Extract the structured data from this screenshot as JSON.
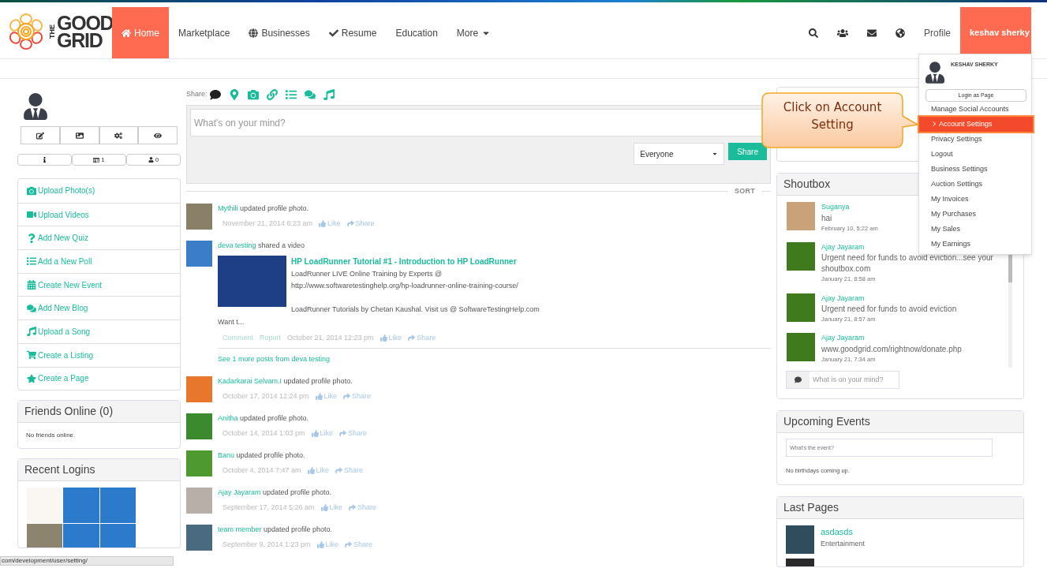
{
  "nav": {
    "logo": {
      "small": "THE",
      "top": "GOOD",
      "bottom": "GRID"
    },
    "items": [
      {
        "label": "Home",
        "kind": "home",
        "selected": true
      },
      {
        "label": "Marketplace",
        "kind": "plain",
        "selected": false
      },
      {
        "label": "Businesses",
        "kind": "globe",
        "selected": false
      },
      {
        "label": "Resume",
        "kind": "check",
        "selected": false
      },
      {
        "label": "Education",
        "kind": "plain",
        "selected": false
      },
      {
        "label": "More",
        "kind": "dropdown",
        "selected": false
      }
    ],
    "profile": "Profile",
    "user": "keshav sherky"
  },
  "user_menu": {
    "name": "KESHAV SHERKY",
    "login_button": "Login as Page",
    "items": [
      {
        "label": "Manage Social Accounts",
        "selected": false
      },
      {
        "label": "Account Settings",
        "selected": true
      },
      {
        "label": "Privacy Settings",
        "selected": false
      },
      {
        "label": "Logout",
        "selected": false
      },
      {
        "label": "Business Settings",
        "selected": false
      },
      {
        "label": "Auction Settings",
        "selected": false
      },
      {
        "label": "My Invoices",
        "selected": false
      },
      {
        "label": "My Purchases",
        "selected": false
      },
      {
        "label": "My Sales",
        "selected": false
      },
      {
        "label": "My Earnings",
        "selected": false
      }
    ]
  },
  "callout": {
    "text": "Click on Account Setting"
  },
  "left": {
    "stats": [
      {
        "kind": "photos",
        "value": "1"
      },
      {
        "kind": "friends",
        "value": "0"
      }
    ],
    "actions": [
      {
        "label": "Upload Photo(s)",
        "kind": "photo"
      },
      {
        "label": "Upload Videos",
        "kind": "video"
      },
      {
        "label": "Add New Quiz",
        "kind": "quiz"
      },
      {
        "label": "Add a New Poll",
        "kind": "poll"
      },
      {
        "label": "Create New Event",
        "kind": "event"
      },
      {
        "label": "Add New Blog",
        "kind": "blog"
      },
      {
        "label": "Upload a Song",
        "kind": "song"
      },
      {
        "label": "Create a Listing",
        "kind": "listing"
      },
      {
        "label": "Create a Page",
        "kind": "page"
      }
    ],
    "friends_online": {
      "title": "Friends Online (0)",
      "empty_text": "No friends online."
    },
    "recent_logins": {
      "title": "Recent Logins"
    }
  },
  "composer": {
    "share_label": "Share:",
    "placeholder": "What's on your mind?",
    "audience": "Everyone",
    "button": "Share",
    "sort": "SORT"
  },
  "feed": [
    {
      "kind": "photo",
      "author": "Mythili",
      "action": "updated profile photo.",
      "date": "November 21, 2014 6:23 am",
      "like": "Like",
      "share": "Share"
    },
    {
      "kind": "video",
      "author": "deva testing",
      "action": "shared a video",
      "date": "October 21, 2014 12:23 pm",
      "like": "Like",
      "share": "Share",
      "video": {
        "title": "HP LoadRunner Tutorial #1 - Introduction to HP LoadRunner",
        "lines": [
          "LoadRunner LIVE Online Training by Experts @",
          "http://www.softwaretestinghelp.org/hp-loadrunner-online-training-course/",
          "LoadRunner Tutorials by Chetan Kaushal. Visit us @ SoftwareTestingHelp.com"
        ],
        "more": "Want t...",
        "comment": "Comment",
        "report": "Report",
        "see_more": "See 1 more posts from deva testing"
      }
    },
    {
      "kind": "photo",
      "author": "Kadarkarai Selvam.I",
      "action": "updated profile photo.",
      "date": "October 17, 2014 12:24 pm",
      "like": "Like",
      "share": "Share"
    },
    {
      "kind": "photo",
      "author": "Anitha",
      "action": "updated profile photo.",
      "date": "October 14, 2014 1:03 pm",
      "like": "Like",
      "share": "Share"
    },
    {
      "kind": "photo",
      "author": "Banu",
      "action": "updated profile photo.",
      "date": "October 4, 2014 7:47 am",
      "like": "Like",
      "share": "Share"
    },
    {
      "kind": "photo",
      "author": "Ajay Jayaram",
      "action": "updated profile photo.",
      "date": "September 17, 2014 5:26 am",
      "like": "Like",
      "share": "Share"
    },
    {
      "kind": "photo",
      "author": "team member",
      "action": "updated profile photo.",
      "date": "September 9, 2014 1:23 pm",
      "like": "Like",
      "share": "Share"
    }
  ],
  "shoutbox": {
    "title": "Shoutbox",
    "messages": [
      {
        "author": "Suganya",
        "text": "hai",
        "time": "February 10, 5:22 am"
      },
      {
        "author": "Ajay Jayaram",
        "text": "Urgent need for funds to avoid eviction...see your shoutbox.com",
        "time": "January 21, 8:58 am"
      },
      {
        "author": "Ajay Jayaram",
        "text": "Urgent need for funds to avoid eviction",
        "time": "January 21, 8:57 am"
      },
      {
        "author": "Ajay Jayaram",
        "text": "www.goodgrid.com/rightnow/donate.php",
        "time": "January 21, 7:34 am"
      }
    ],
    "placeholder": "What is on your mind?"
  },
  "upcoming_events": {
    "title": "Upcoming Events",
    "placeholder": "What's the event?",
    "empty_text": "No birthdays coming up."
  },
  "last_pages": {
    "title": "Last Pages",
    "pages": [
      {
        "name": "asdasds",
        "category": "Entertainment"
      }
    ]
  },
  "status_bar": {
    "url": "com/development/user/setting/"
  }
}
